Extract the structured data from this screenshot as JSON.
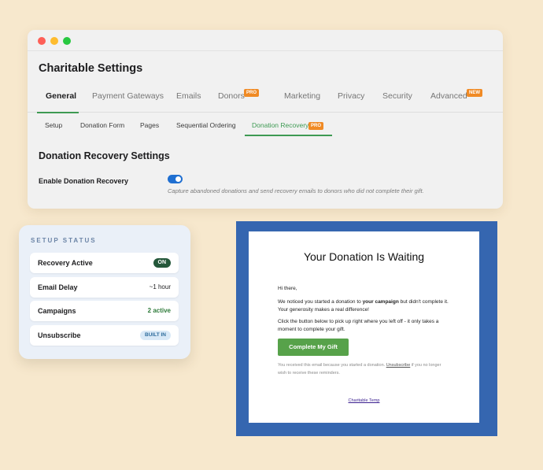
{
  "window": {
    "title": "Charitable Settings",
    "tabs": [
      {
        "label": "General"
      },
      {
        "label": "Payment Gateways"
      },
      {
        "label": "Emails"
      },
      {
        "label": "Donors",
        "badge": "PRO"
      },
      {
        "label": "Marketing"
      },
      {
        "label": "Privacy"
      },
      {
        "label": "Security"
      },
      {
        "label": "Advanced",
        "badge": "NEW"
      }
    ],
    "active_tab": "General",
    "subtabs": [
      {
        "label": "Setup"
      },
      {
        "label": "Donation Form"
      },
      {
        "label": "Pages"
      },
      {
        "label": "Sequential Ordering"
      },
      {
        "label": "Donation Recovery",
        "badge": "PRO"
      }
    ],
    "active_subtab": "Donation Recovery",
    "section_title": "Donation Recovery Settings",
    "field": {
      "label": "Enable Donation Recovery",
      "enabled": true,
      "description": "Capture abandoned donations and send recovery emails to donors who did not complete their gift."
    }
  },
  "status": {
    "heading": "SETUP STATUS",
    "rows": [
      {
        "label": "Recovery Active",
        "value": "ON"
      },
      {
        "label": "Email Delay",
        "value": "~1 hour"
      },
      {
        "label": "Campaigns",
        "value": "2 active"
      },
      {
        "label": "Unsubscribe",
        "value": "BUILT IN"
      }
    ]
  },
  "email": {
    "title": "Your Donation Is Waiting",
    "greeting": "Hi there,",
    "para1_start": "We noticed you started a donation to ",
    "para1_bold": "your campaign",
    "para1_end": " but didn't complete it.",
    "para1_line2": "Your generosity makes a real difference!",
    "para2_line1": "Click the button below to pick up right where you left off - it only takes a",
    "para2_line2": "moment to complete your gift.",
    "button": "Complete My Gift",
    "footer_start": "You received this email because you started a donation. ",
    "footer_link": "Unsubscribe",
    "footer_end": " if you no longer",
    "footer_line2": "wish to receive these reminders.",
    "brand_link": "Charitable Temp"
  },
  "colors": {
    "background": "#f7e8cd",
    "accent_green": "#3e9a53",
    "toggle_blue": "#1f6fd1",
    "badge_orange": "#f08a24",
    "email_frame": "#3566b0"
  }
}
